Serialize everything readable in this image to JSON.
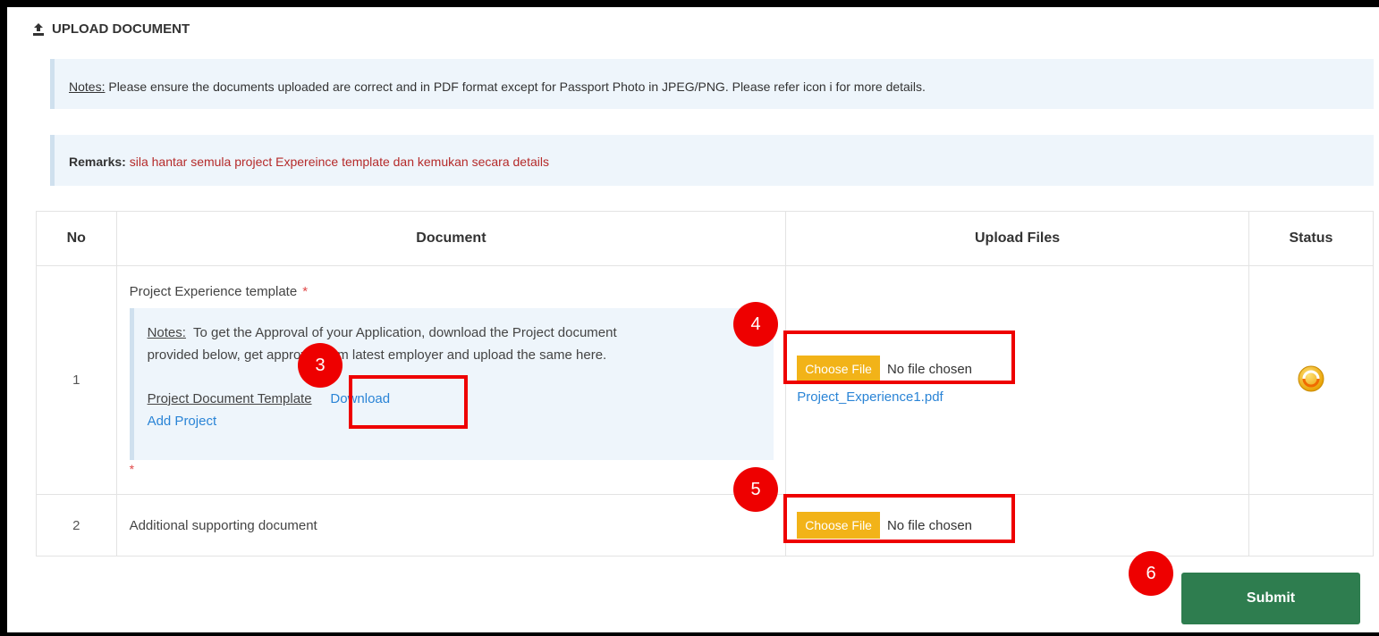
{
  "header": {
    "title": "UPLOAD DOCUMENT",
    "icon": "upload-icon"
  },
  "notes": {
    "label": "Notes:",
    "text": "Please ensure the documents uploaded are correct and in PDF format except for Passport Photo in JPEG/PNG. Please refer icon i for more details."
  },
  "remarks": {
    "label": "Remarks:",
    "text": "sila hantar semula project Expereince template dan kemukan secara details",
    "color": "#b52a2a"
  },
  "table": {
    "headers": [
      "No",
      "Document",
      "Upload Files",
      "Status"
    ],
    "rows": [
      {
        "no": "1",
        "title": "Project Experience template",
        "required_mark": "*",
        "note_label": "Notes:",
        "note_line1": "To get the Approval of your Application, download the Project document",
        "note_line2": "provided below, get approval from latest employer and upload the same here.",
        "template_label": "Project Document Template",
        "download_label": "Download",
        "add_project_label": "Add Project",
        "required_mark_bottom": "*",
        "choose_label": "Choose File",
        "file_status": "No file chosen",
        "uploaded_file": "Project_Experience1.pdf",
        "status_icon": "pending-status-icon"
      },
      {
        "no": "2",
        "title": "Additional supporting document",
        "choose_label": "Choose File",
        "file_status": "No file chosen"
      }
    ]
  },
  "annotations": {
    "b3": "3",
    "b4": "4",
    "b5": "5",
    "b6": "6"
  },
  "submit_label": "Submit",
  "colors": {
    "accent_orange": "#f2b318",
    "submit_green": "#2e7d4f",
    "link_blue": "#2a84d6",
    "highlight_red": "#ee0000"
  }
}
